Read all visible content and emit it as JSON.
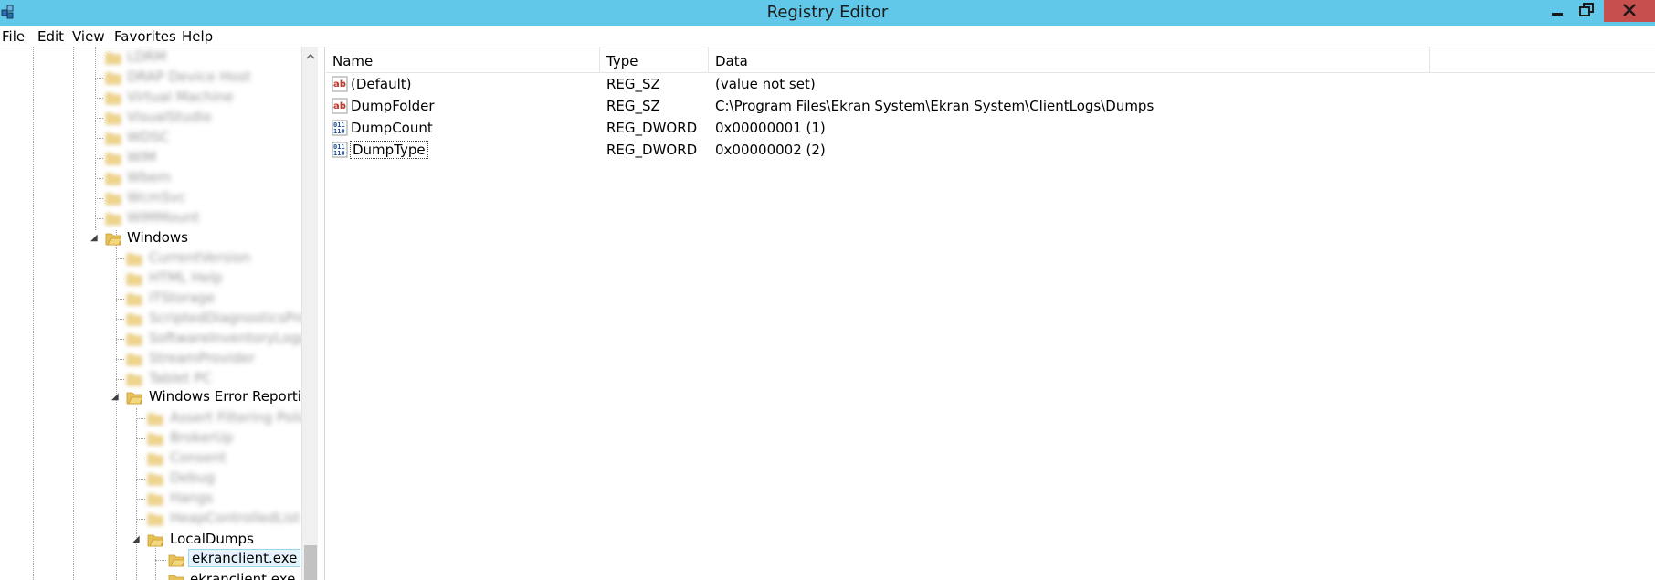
{
  "window": {
    "title": "Registry Editor"
  },
  "menu": [
    "File",
    "Edit",
    "View",
    "Favorites",
    "Help"
  ],
  "tree": {
    "blurred_upper": [
      "LDRM",
      "DRAP Device Host",
      "Virtual Machine",
      "VisualStudio",
      "WDSC",
      "WIM",
      "Wbem",
      "WcmSvc",
      "WIMMount"
    ],
    "windows": "Windows",
    "blurred_windows": [
      "CurrentVersion",
      "HTML Help",
      "ITStorage",
      "ScriptedDiagnosticsProvider",
      "SoftwareInventoryLogging",
      "StreamProvider",
      "Tablet PC"
    ],
    "wer": "Windows Error Reporting",
    "blurred_wer": [
      "Assert Filtering Policy",
      "BrokerUp",
      "Consent",
      "Debug",
      "Hangs",
      "HeapControlledList"
    ],
    "localdumps": "LocalDumps",
    "selected": "ekranclient.exe",
    "partial": "ekranclient.exe"
  },
  "list": {
    "columns": [
      "Name",
      "Type",
      "Data"
    ],
    "rows": [
      {
        "name": "(Default)",
        "type": "REG_SZ",
        "data": "(value not set)",
        "icon": "string-value-icon"
      },
      {
        "name": "DumpFolder",
        "type": "REG_SZ",
        "data": "C:\\Program Files\\Ekran System\\Ekran System\\ClientLogs\\Dumps",
        "icon": "string-value-icon"
      },
      {
        "name": "DumpCount",
        "type": "REG_DWORD",
        "data": "0x00000001 (1)",
        "icon": "binary-value-icon"
      },
      {
        "name": "DumpType",
        "type": "REG_DWORD",
        "data": "0x00000002 (2)",
        "icon": "binary-value-icon"
      }
    ]
  },
  "colors": {
    "titlebar": "#62c8ea",
    "close": "#c7504e",
    "folder": "#e8c25a"
  }
}
